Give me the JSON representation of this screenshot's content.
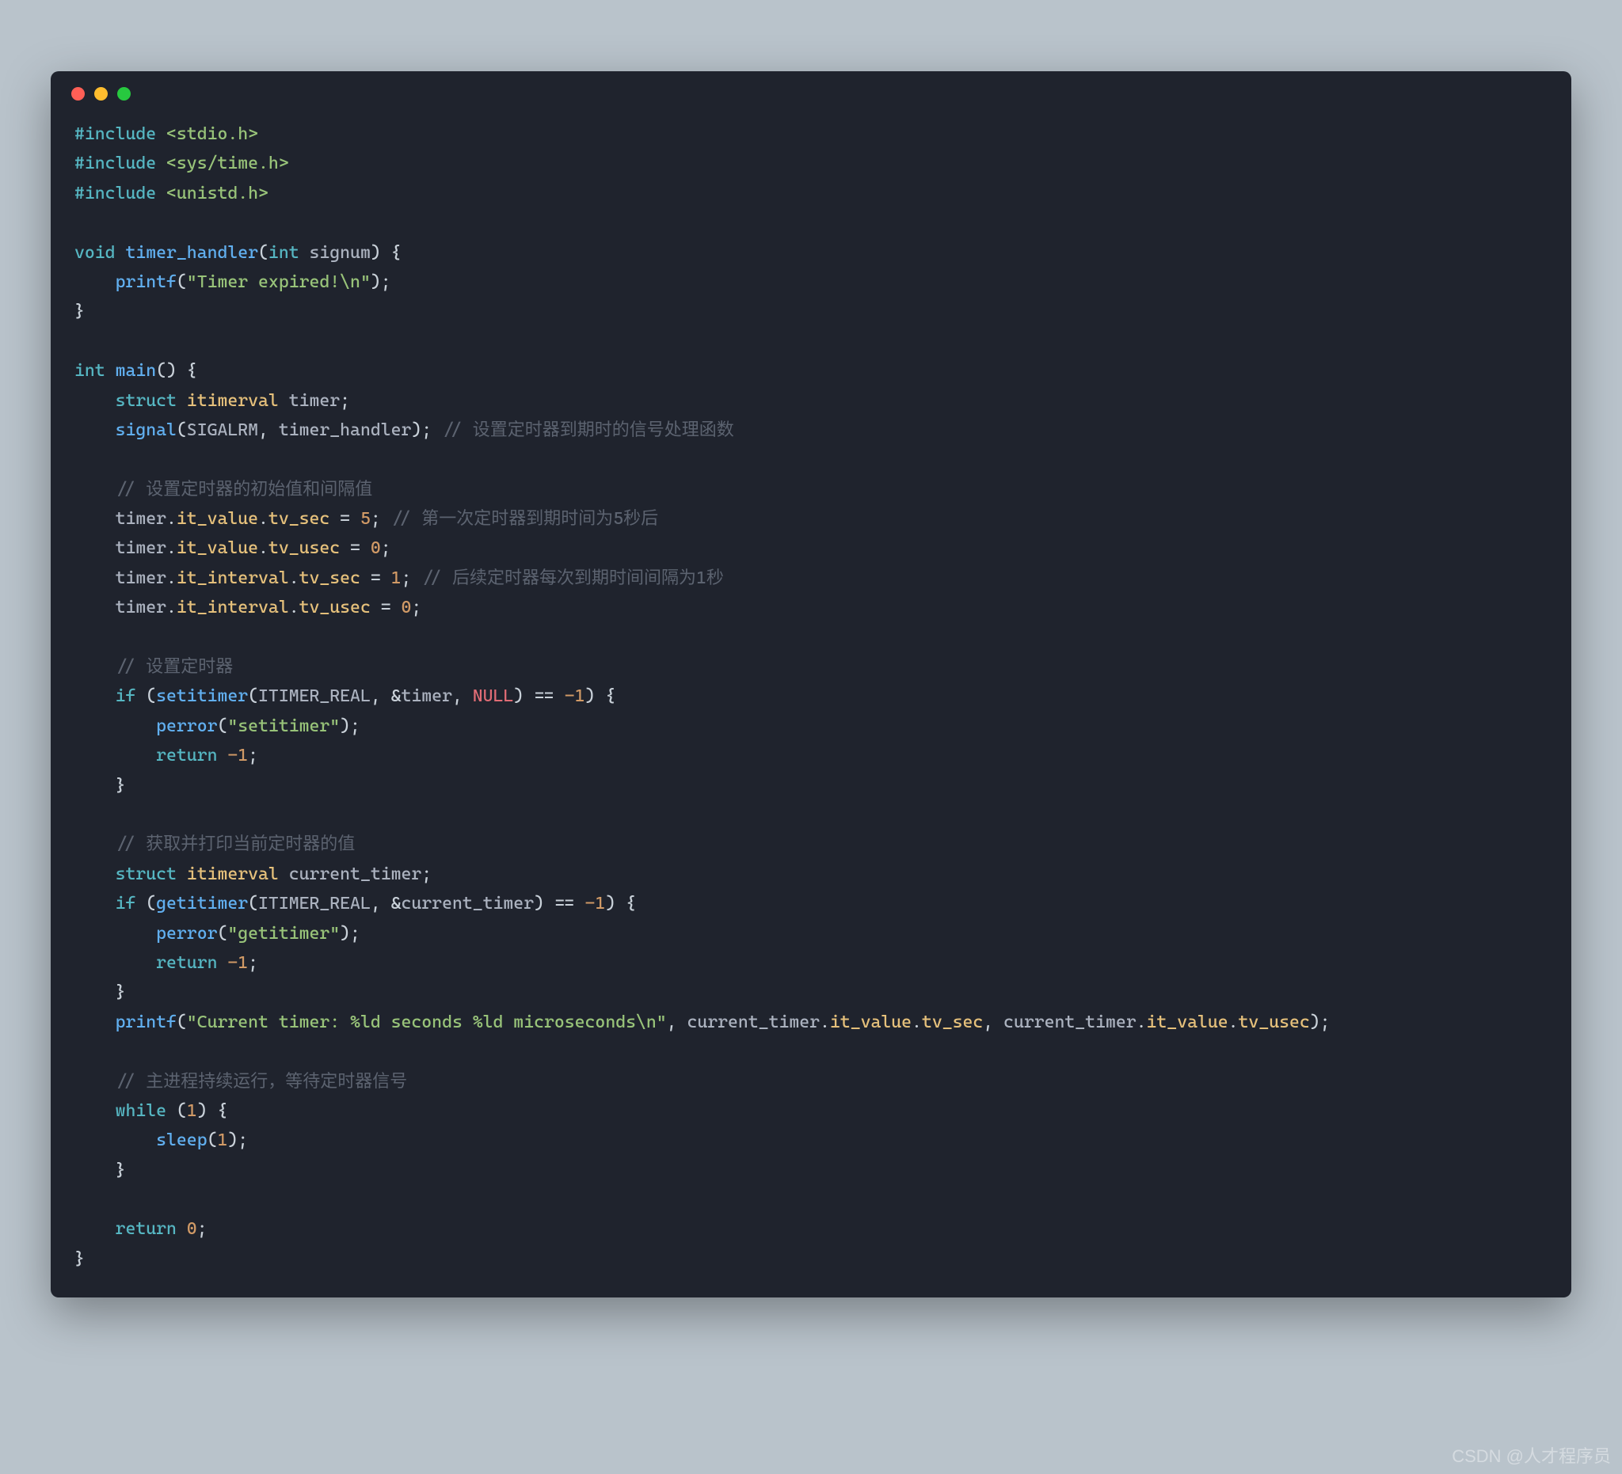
{
  "meta": {
    "watermark": "CSDN @人才程序员"
  },
  "code": {
    "line1": {
      "pre": "#include",
      "inc": " <stdio.h>"
    },
    "line2": {
      "pre": "#include",
      "inc": " <sys/time.h>"
    },
    "line3": {
      "pre": "#include",
      "inc": " <unistd.h>"
    },
    "sig": {
      "kw_void": "void",
      "fn": "timer_handler",
      "kw_int": "int",
      "param": "signum"
    },
    "printf1": {
      "fn": "printf",
      "str": "\"Timer expired!\\n\""
    },
    "main": {
      "kw_int": "int",
      "fn": "main"
    },
    "decl1": {
      "kw": "struct",
      "type": "itimerval",
      "name": "timer"
    },
    "sigcall": {
      "fn": "signal",
      "c1": "SIGALRM",
      "c2": "timer_handler",
      "cmt": "// 设置定时器到期时的信号处理函数"
    },
    "cmt_block1": "// 设置定时器的初始值和间隔值",
    "stmt_tv_sec": {
      "lhs1": "timer",
      "lhs2": "it_value",
      "lhs3": "tv_sec",
      "val": "5",
      "cmt": "// 第一次定时器到期时间为5秒后"
    },
    "stmt_tv_usec": {
      "lhs1": "timer",
      "lhs2": "it_value",
      "lhs3": "tv_usec",
      "val": "0"
    },
    "stmt_int_sec": {
      "lhs1": "timer",
      "lhs2": "it_interval",
      "lhs3": "tv_sec",
      "val": "1",
      "cmt": "// 后续定时器每次到期时间间隔为1秒"
    },
    "stmt_int_usec": {
      "lhs1": "timer",
      "lhs2": "it_interval",
      "lhs3": "tv_usec",
      "val": "0"
    },
    "cmt_block2": "// 设置定时器",
    "setitimer": {
      "kw_if": "if",
      "fn": "setitimer",
      "c1": "ITIMER_REAL",
      "c2": "timer",
      "c3": "NULL",
      "neg1": "-1"
    },
    "perror1": {
      "fn": "perror",
      "str": "\"setitimer\""
    },
    "ret_neg1a": {
      "kw": "return",
      "val": "-1"
    },
    "cmt_block3": "// 获取并打印当前定时器的值",
    "decl2": {
      "kw": "struct",
      "type": "itimerval",
      "name": "current_timer"
    },
    "getitimer": {
      "kw_if": "if",
      "fn": "getitimer",
      "c1": "ITIMER_REAL",
      "c2": "current_timer",
      "neg1": "-1"
    },
    "perror2": {
      "fn": "perror",
      "str": "\"getitimer\""
    },
    "ret_neg1b": {
      "kw": "return",
      "val": "-1"
    },
    "printf2": {
      "fn": "printf",
      "str": "\"Current timer: %ld seconds %ld microseconds\\n\"",
      "a1": "current_timer",
      "a1m1": "it_value",
      "a1m2": "tv_sec",
      "a2": "current_timer",
      "a2m1": "it_value",
      "a2m2": "tv_usec"
    },
    "cmt_block4": "// 主进程持续运行，等待定时器信号",
    "while": {
      "kw": "while",
      "val": "1"
    },
    "sleep": {
      "fn": "sleep",
      "val": "1"
    },
    "ret0": {
      "kw": "return",
      "val": "0"
    }
  }
}
